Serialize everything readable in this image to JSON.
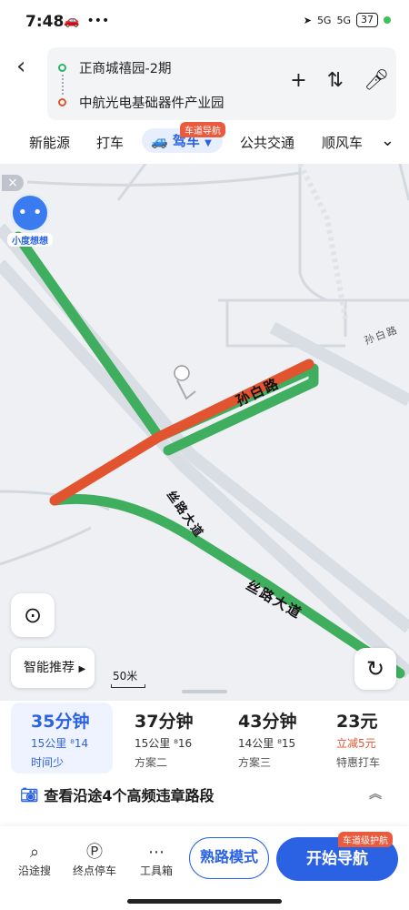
{
  "status": {
    "time": "7:48",
    "signal_a": "5G",
    "signal_b": "5G",
    "battery": "37"
  },
  "route": {
    "from": "正商城禧园-2期",
    "to": "中航光电基础器件产业园"
  },
  "modes": {
    "items": [
      "新能源",
      "打车",
      "驾车",
      "公共交通",
      "顺风车"
    ],
    "active_badge": "车道导航"
  },
  "map": {
    "roads": [
      "孙白路",
      "丝路大道",
      "丝路大道",
      "孙白路"
    ],
    "assistant_label": "小度想想",
    "smart_btn": "智能推荐",
    "scale": "50米",
    "colors": {
      "route_green": "#3fae5f",
      "route_red": "#e2542f",
      "road_gray": "#d7dbe2"
    }
  },
  "plans": [
    {
      "time": "35分钟",
      "dist": "15公里",
      "lights": "14",
      "note": "时间少"
    },
    {
      "time": "37分钟",
      "dist": "15公里",
      "lights": "16",
      "note": "方案二"
    },
    {
      "time": "43分钟",
      "dist": "14公里",
      "lights": "15",
      "note": "方案三"
    },
    {
      "time": "23元",
      "dist": "立减5元",
      "lights": "",
      "note": "特惠打车"
    }
  ],
  "violation": "查看沿途4个高频违章路段",
  "bottom": {
    "tools": [
      "沿途搜",
      "终点停车",
      "工具箱"
    ],
    "familiar": "熟路模式",
    "nav": "开始导航",
    "nav_badge": "车道级护航"
  }
}
